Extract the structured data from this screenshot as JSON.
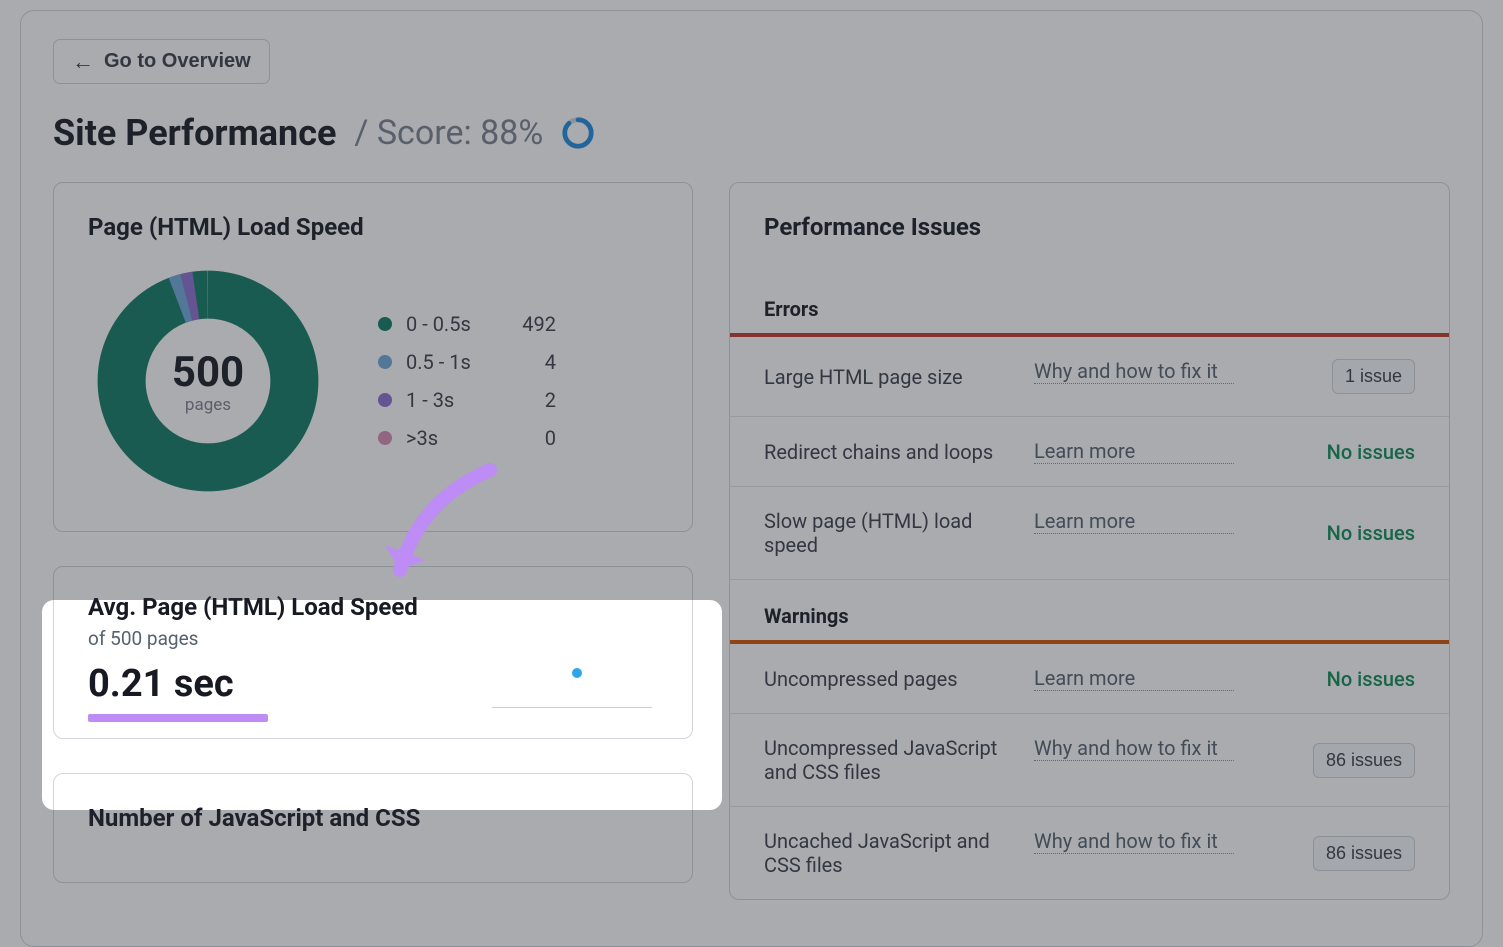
{
  "nav": {
    "back_label": "Go to Overview"
  },
  "header": {
    "title": "Site Performance",
    "score_prefix": "/ Score:",
    "score_value": "88%"
  },
  "donut_card": {
    "title": "Page (HTML) Load Speed",
    "total": "500",
    "total_label": "pages",
    "legend": [
      {
        "label": "0 - 0.5s",
        "value": "492",
        "color": "#117a65"
      },
      {
        "label": "0.5 - 1s",
        "value": "4",
        "color": "#6fa8dc"
      },
      {
        "label": "1 - 3s",
        "value": "2",
        "color": "#8e6fd1"
      },
      {
        "label": ">3s",
        "value": "0",
        "color": "#d98cb3"
      }
    ]
  },
  "avg_card": {
    "title": "Avg. Page (HTML) Load Speed",
    "subtitle": "of 500 pages",
    "value": "0.21 sec"
  },
  "js_css_card": {
    "title": "Number of JavaScript and CSS"
  },
  "issues_panel": {
    "title": "Performance Issues",
    "sections": [
      {
        "name": "Errors",
        "accent": "#c0392b",
        "rows": [
          {
            "name": "Large HTML page size",
            "link": "Why and how to fix it",
            "status_type": "badge",
            "status": "1 issue"
          },
          {
            "name": "Redirect chains and loops",
            "link": "Learn more",
            "status_type": "ok",
            "status": "No issues"
          },
          {
            "name": "Slow page (HTML) load speed",
            "link": "Learn more",
            "status_type": "ok",
            "status": "No issues"
          }
        ]
      },
      {
        "name": "Warnings",
        "accent": "#d35400",
        "rows": [
          {
            "name": "Uncompressed pages",
            "link": "Learn more",
            "status_type": "ok",
            "status": "No issues"
          },
          {
            "name": "Uncompressed JavaScript and CSS files",
            "link": "Why and how to fix it",
            "status_type": "badge",
            "status": "86 issues"
          },
          {
            "name": "Uncached JavaScript and CSS files",
            "link": "Why and how to fix it",
            "status_type": "badge",
            "status": "86 issues"
          }
        ]
      }
    ]
  },
  "chart_data": {
    "type": "pie",
    "title": "Page (HTML) Load Speed",
    "categories": [
      "0 - 0.5s",
      "0.5 - 1s",
      "1 - 3s",
      ">3s"
    ],
    "values": [
      492,
      4,
      2,
      0
    ],
    "total": 500,
    "total_label": "pages",
    "colors": [
      "#117a65",
      "#6fa8dc",
      "#8e6fd1",
      "#d98cb3"
    ]
  }
}
